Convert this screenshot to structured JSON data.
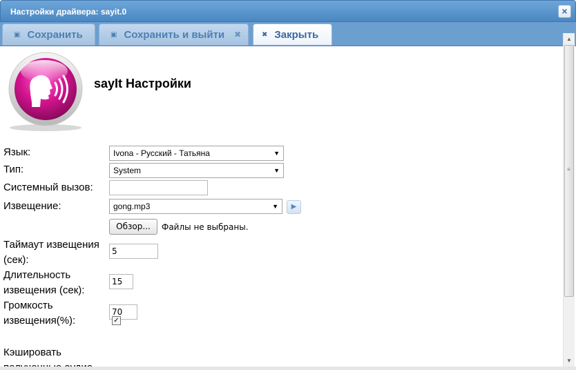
{
  "window": {
    "title": "Настройки драйвера: sayit.0",
    "close_glyph": "×"
  },
  "toolbar": {
    "save_label": "Сохранить",
    "save_exit_label": "Сохранить и выйти",
    "close_label": "Закрыть",
    "save_icon": "floppy-icon",
    "close_icon": "x-icon"
  },
  "header": {
    "title": "sayIt Настройки",
    "logo_icon": "speaking-head-icon",
    "logo_color": "#d4148f"
  },
  "form": {
    "language": {
      "label": "Язык:",
      "value": "Ivona - Русский - Татьяна"
    },
    "type": {
      "label": "Тип:",
      "value": "System"
    },
    "system_call": {
      "label": "Системный вызов:",
      "value": ""
    },
    "notification": {
      "label": "Извещение:",
      "value": "gong.mp3"
    },
    "file": {
      "button_label": "Обзор...",
      "status": "Файлы не выбраны."
    },
    "notification_timeout": {
      "label_line1": "Таймаут извещения",
      "label_line2": "(сек):",
      "value": "5"
    },
    "notification_duration": {
      "label_line1": "Длительность",
      "label_line2": "извещения (сек):",
      "value": "15"
    },
    "notification_volume": {
      "label_line1": "Громкость",
      "label_line2": "извещения(%):",
      "value": "70"
    },
    "cache": {
      "label_line1": "Кэшировать",
      "label_line2": "полученные аудио"
    }
  }
}
